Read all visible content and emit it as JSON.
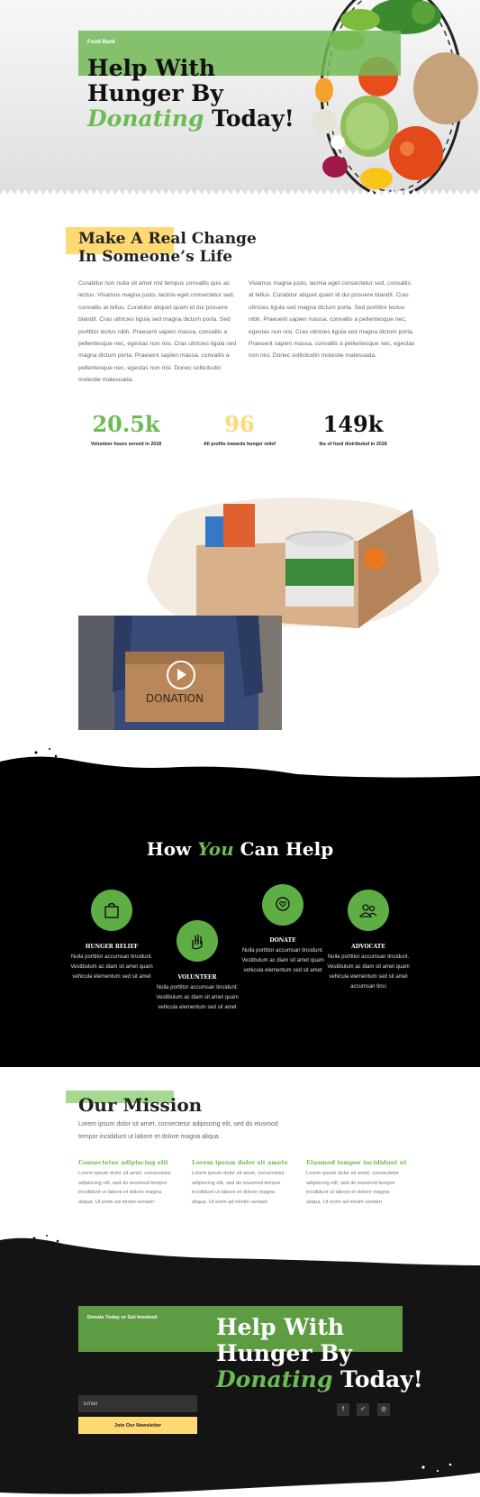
{
  "hero": {
    "eyebrow": "Food Bank",
    "title_line1": "Help With",
    "title_line2_bold": "Hunger",
    "title_line2_rest": " By",
    "title_line3_green": "Donating",
    "title_line3_rest": " Today!"
  },
  "change": {
    "title_line1": "Make A Real Change",
    "title_line2": "In Someone’s Life",
    "para_left": "Curabitur non nulla sit amet nisl tempus convallis quis ac lectus. Vivamus magna justo, lacinia eget consectetur sed, convallis at tellus. Curabitur aliquet quam id dui posuere blandit. Cras ultricies ligula sed magna dictum porta. Sed porttitor lectus nibh. Praesent sapien massa, convallis a pellentesque nec, egestas non nisi. Cras ultricies ligula sed magna dictum porta. Praesent sapien massa, convallis a pellentesque nec, egestas non nisi. Donec sollicitudin molestie malesuada.",
    "para_right": "Vivamus magna justo, lacinia eget consectetur sed, convallis at tellus. Curabitur aliquet quam id dui posuere blandit. Cras ultricies ligula sed magna dictum porta. Sed porttitor lectus nibh. Praesent sapien massa, convallis a pellentesque nec, egestas non nisi. Cras ultricies ligula sed magna dictum porta. Praesent sapien massa, convallis a pellentesque nec, egestas non nisi. Donec sollicitudin molestie malesuada."
  },
  "stats": [
    {
      "value": "20.5k",
      "label": "Volunteer hours served in 2018",
      "color": "#6dbb55"
    },
    {
      "value": "96",
      "label": "All profits towards hunger relief",
      "color": "#ffd973"
    },
    {
      "value": "149k",
      "label": "lbs of food distributed in 2018",
      "color": "#111111"
    }
  ],
  "video": {
    "box_text": "DONATION"
  },
  "help": {
    "title_pre": "How ",
    "title_green": "You",
    "title_mid": " Can ",
    "title_bold": "Help",
    "items": [
      {
        "title": "HUNGER RELIEF",
        "text": "Nulla porttitor accumsan tincidunt. Vestibulum ac diam sit amet quam vehicula elementum sed sit amet",
        "icon": "bag-icon"
      },
      {
        "title": "VOLUNTEER",
        "text": "Nulla porttitor accumsan tincidunt. Vestibulum ac diam sit amet quam vehicula elementum sed sit amet",
        "icon": "hand-heart-icon"
      },
      {
        "title": "DONATE",
        "text": "Nulla porttitor accumsan tincidunt. Vestibulum ac diam sit amet quam vehicula elementum sed sit amet",
        "icon": "heart-hand-icon"
      },
      {
        "title": "ADVOCATE",
        "text": "Nulla porttitor accumsan tincidunt. Vestibulum ac diam sit amet quam vehicula elementum sed sit amet accumsan tinci",
        "icon": "people-icon"
      }
    ]
  },
  "mission": {
    "title": "Our Mission",
    "intro": "Lorem ipsum dolor sit amet, consectetur adipiscing elit, sed do eiusmod tempor incididunt ut labore et dolore magna aliqua.",
    "columns": [
      {
        "title": "Consectetur adipiscing elit",
        "text": "Lorem ipsum dolor sit amet, consectetur adipiscing elit, sed do eiusmod tempor incididunt ut labore et dolore magna aliqua. Ut enim ad minim veniam"
      },
      {
        "title": "Lorem ipsum dolor sit ametx",
        "text": "Lorem ipsum dolor sit amet, consectetur adipiscing elit, sed do eiusmod tempor incididunt ut labore et dolore magna aliqua. Ut enim ad minim veniam"
      },
      {
        "title": "Eiusmod tempor incididunt ut",
        "text": "Lorem ipsum dolor sit amet, consectetur adipiscing elit, sed do eiusmod tempor incididunt ut labore et dolore magna aliqua. Ut enim ad minim veniam"
      }
    ]
  },
  "footer": {
    "eyebrow": "Donate Today or Get Involved",
    "title_line1": "Help With",
    "title_line2_bold": "Hunger",
    "title_line2_rest": " By",
    "title_line3_green": "Donating",
    "title_line3_rest": " Today!",
    "email_placeholder": "Email",
    "newsletter_label": "Join Our Newsletter",
    "social": [
      {
        "icon": "facebook-icon",
        "glyph": "f"
      },
      {
        "icon": "twitter-icon",
        "glyph": "✓"
      },
      {
        "icon": "instagram-icon",
        "glyph": "◎"
      }
    ]
  },
  "colors": {
    "green": "#6dbb55",
    "yellow": "#ffd973",
    "dark": "#141414"
  }
}
